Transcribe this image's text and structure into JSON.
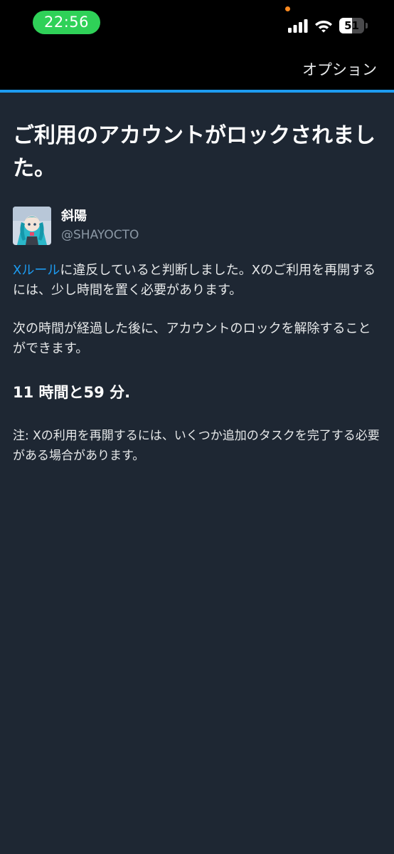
{
  "status_bar": {
    "time": "22:56",
    "battery_level": "51",
    "battery_fraction": 0.51,
    "colors": {
      "time_pill": "#2fd158",
      "privacy_dot": "#ff8a1f"
    }
  },
  "header": {
    "options_label": "オプション",
    "accent_color": "#1d9bf0"
  },
  "main": {
    "title": "ご利用のアカウントがロックされました。",
    "profile": {
      "display_name": "斜陽",
      "username": "@SHAYOCTO",
      "avatar_icon": "anime-character-avatar"
    },
    "paragraph1": {
      "link_text": "Xルール",
      "text": "に違反していると判断しました。Xのご利用を再開するには、少し時間を置く必要があります。"
    },
    "paragraph2": "次の時間が経過した後に、アカウントのロックを解除することができます。",
    "countdown": "11 時間と59 分.",
    "note": "注: Xの利用を再開するには、いくつか追加のタスクを完了する必要がある場合があります。"
  }
}
